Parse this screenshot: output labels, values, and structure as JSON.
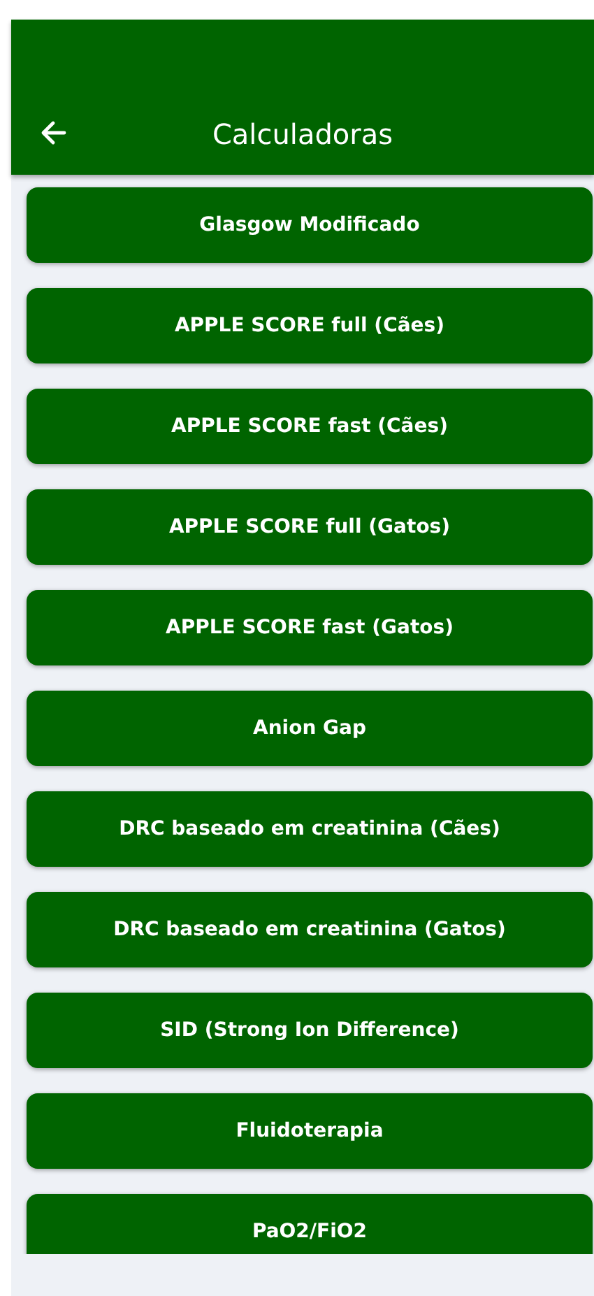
{
  "app_bar": {
    "title": "Calculadoras"
  },
  "calculators": [
    {
      "label": "Glasgow Modificado"
    },
    {
      "label": "APPLE SCORE full (Cães)"
    },
    {
      "label": "APPLE SCORE fast (Cães)"
    },
    {
      "label": "APPLE SCORE full (Gatos)"
    },
    {
      "label": "APPLE SCORE fast (Gatos)"
    },
    {
      "label": "Anion Gap"
    },
    {
      "label": "DRC baseado em creatinina (Cães)"
    },
    {
      "label": "DRC baseado em creatinina (Gatos)"
    },
    {
      "label": "SID (Strong Ion Difference)"
    },
    {
      "label": "Fluidoterapia"
    },
    {
      "label": "PaO2/FiO2"
    }
  ]
}
